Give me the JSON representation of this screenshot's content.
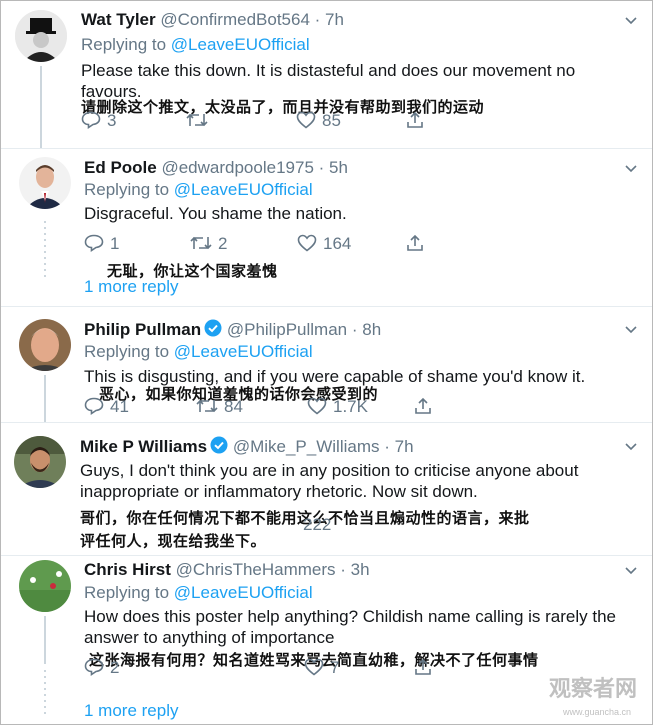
{
  "tweets": [
    {
      "name": "Wat Tyler",
      "handle": "@ConfirmedBot564",
      "time": "7h",
      "replying_prefix": "Replying to ",
      "replying_to": "@LeaveEUOfficial",
      "text": "Please take this down. It is distasteful and does our movement no favours.",
      "cn_caption": "请删除这个推文，太没品了，而且并没有帮助到我们的运动",
      "replies": "3",
      "retweets": "",
      "likes": "85"
    },
    {
      "name": "Ed Poole",
      "handle": "@edwardpoole1975",
      "time": "5h",
      "replying_prefix": "Replying to ",
      "replying_to": "@LeaveEUOfficial",
      "text": "Disgraceful. You shame the nation.",
      "cn_caption": "无耻，你让这个国家羞愧",
      "replies": "1",
      "retweets": "2",
      "likes": "164",
      "more_replies": "1 more reply"
    },
    {
      "name": "Philip Pullman",
      "handle": "@PhilipPullman",
      "time": "8h",
      "replying_prefix": "Replying to ",
      "replying_to": "@LeaveEUOfficial",
      "text": "This is disgusting, and if you were capable of shame you'd know it.",
      "cn_caption": "恶心，如果你知道羞愧的话你会感受到的",
      "replies": "41",
      "retweets": "84",
      "likes": "1.7K"
    },
    {
      "name": "Mike P Williams",
      "handle": "@Mike_P_Williams",
      "time": "7h",
      "text": "Guys, I don't think you are in any position to criticise anyone about inappropriate or inflammatory rhetoric. Now sit down.",
      "cn_caption_line1": "哥们，你在任何情况下都不能用这么不恰当且煽动性的语言，来批",
      "cn_caption_line2": "评任何人，现在给我坐下。",
      "likes": "222"
    },
    {
      "name": "Chris Hirst",
      "handle": "@ChrisTheHammers",
      "time": "3h",
      "replying_prefix": "Replying to ",
      "replying_to": "@LeaveEUOfficial",
      "text": "How does this poster help anything? Childish name calling is rarely the answer to anything of importance",
      "cn_caption": "这张海报有何用？知名道姓骂来骂去简直幼稚，解决不了任何事情",
      "replies": "2",
      "likes": "7",
      "more_replies": "1 more reply"
    }
  ],
  "separator": " · ",
  "watermark": "观察者网",
  "watermark_sub": "www.guancha.cn",
  "colors": {
    "link": "#1da1f2",
    "muted": "#657786",
    "verified": "#1da1f2"
  }
}
